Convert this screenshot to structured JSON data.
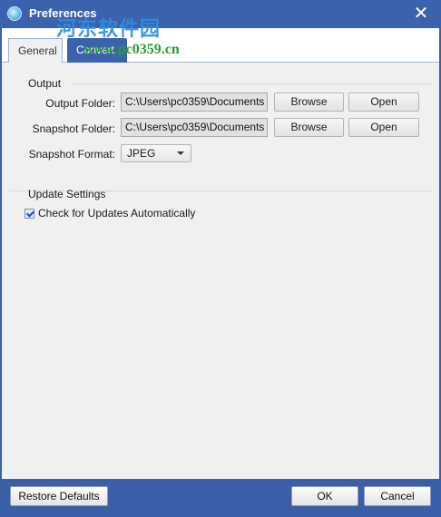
{
  "window": {
    "title": "Preferences",
    "close_glyph": "✕",
    "watermark_text": "河东软件园",
    "watermark_url": "www.pc0359.cn"
  },
  "tabs": [
    {
      "label": "General",
      "active": true
    },
    {
      "label": "Convert",
      "active": false
    }
  ],
  "output": {
    "section_label": "Output",
    "output_folder_label": "Output Folder:",
    "output_folder_value": "C:\\Users\\pc0359\\Documents",
    "snapshot_folder_label": "Snapshot Folder:",
    "snapshot_folder_value": "C:\\Users\\pc0359\\Documents",
    "browse_label": "Browse",
    "open_label": "Open",
    "snapshot_format_label": "Snapshot Format:",
    "snapshot_format_value": "JPEG"
  },
  "update": {
    "section_label": "Update Settings",
    "auto_check_label": "Check for Updates Automatically",
    "auto_check_checked": true
  },
  "footer": {
    "restore_label": "Restore Defaults",
    "ok_label": "OK",
    "cancel_label": "Cancel"
  },
  "colors": {
    "titlebar": "#3b62ad",
    "footer": "#3a5fa8",
    "panel": "#f0f0f0"
  }
}
